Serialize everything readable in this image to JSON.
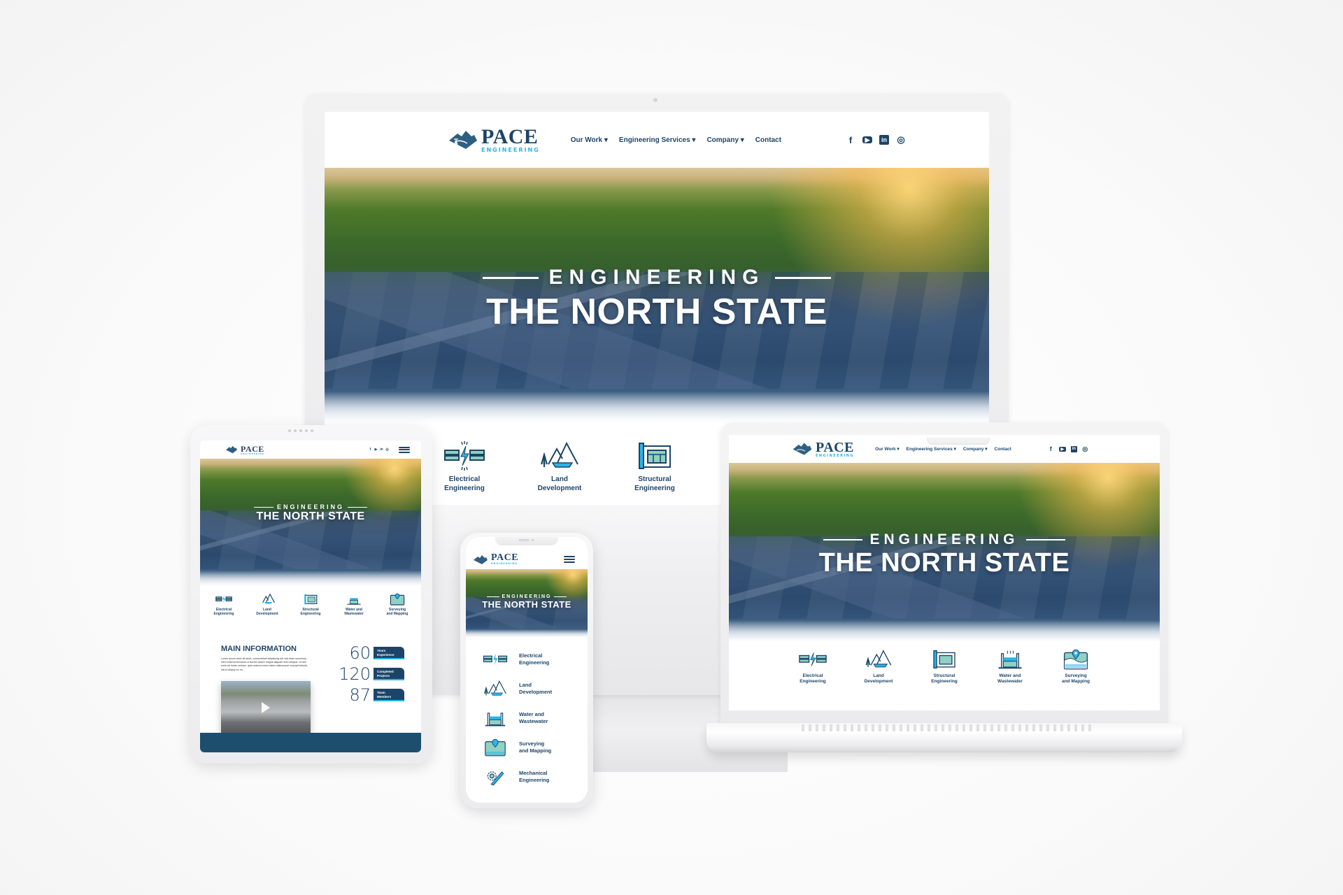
{
  "site": {
    "brand": "PACE",
    "brand_sub": "ENGINEERING",
    "colors": {
      "navy": "#1d4468",
      "cyan": "#29b5e8",
      "teal": "#8fd1c4",
      "footer": "#1d4e6e"
    }
  },
  "nav": {
    "items": [
      {
        "label": "Our Work ▾"
      },
      {
        "label": "Engineering Services ▾"
      },
      {
        "label": "Company ▾"
      },
      {
        "label": "Contact"
      }
    ]
  },
  "social": [
    {
      "icon": "facebook-icon",
      "glyph": "f"
    },
    {
      "icon": "youtube-icon",
      "glyph": "▶"
    },
    {
      "icon": "linkedin-icon",
      "glyph": "in"
    },
    {
      "icon": "instagram-icon",
      "glyph": "◎"
    }
  ],
  "hero": {
    "kicker": "ENGINEERING",
    "title": "THE NORTH STATE"
  },
  "services": [
    {
      "icon": "electrical-icon",
      "line1": "Electrical",
      "line2": "Engineering"
    },
    {
      "icon": "land-development-icon",
      "line1": "Land",
      "line2": "Development"
    },
    {
      "icon": "structural-icon",
      "line1": "Structural",
      "line2": "Engineering"
    },
    {
      "icon": "water-icon",
      "line1": "Water and",
      "line2": "Wastewater"
    },
    {
      "icon": "surveying-icon",
      "line1": "Surveying",
      "line2": "and Mapping"
    },
    {
      "icon": "mechanical-icon",
      "line1": "Mechanical",
      "line2": "Engineering"
    }
  ],
  "main_info": {
    "title": "MAIN INFORMATION",
    "body": "Lorem ipsum dolor sit amet, consectetuer adipiscing elit, sed diam nonummy nibh euismod tincidunt ut laoreet dolore magna aliquam erat volutpat. Ut wisi enim ad minim veniam, quis nostrud exerci tation ullamcorper suscipit lobortis nisl ut aliquip ex ea.",
    "stats": [
      {
        "value": "60",
        "line1": "Years",
        "line2": "Experience"
      },
      {
        "value": "120",
        "line1": "Completed",
        "line2": "Projects"
      },
      {
        "value": "87",
        "line1": "Team",
        "line2": "Members"
      }
    ]
  }
}
